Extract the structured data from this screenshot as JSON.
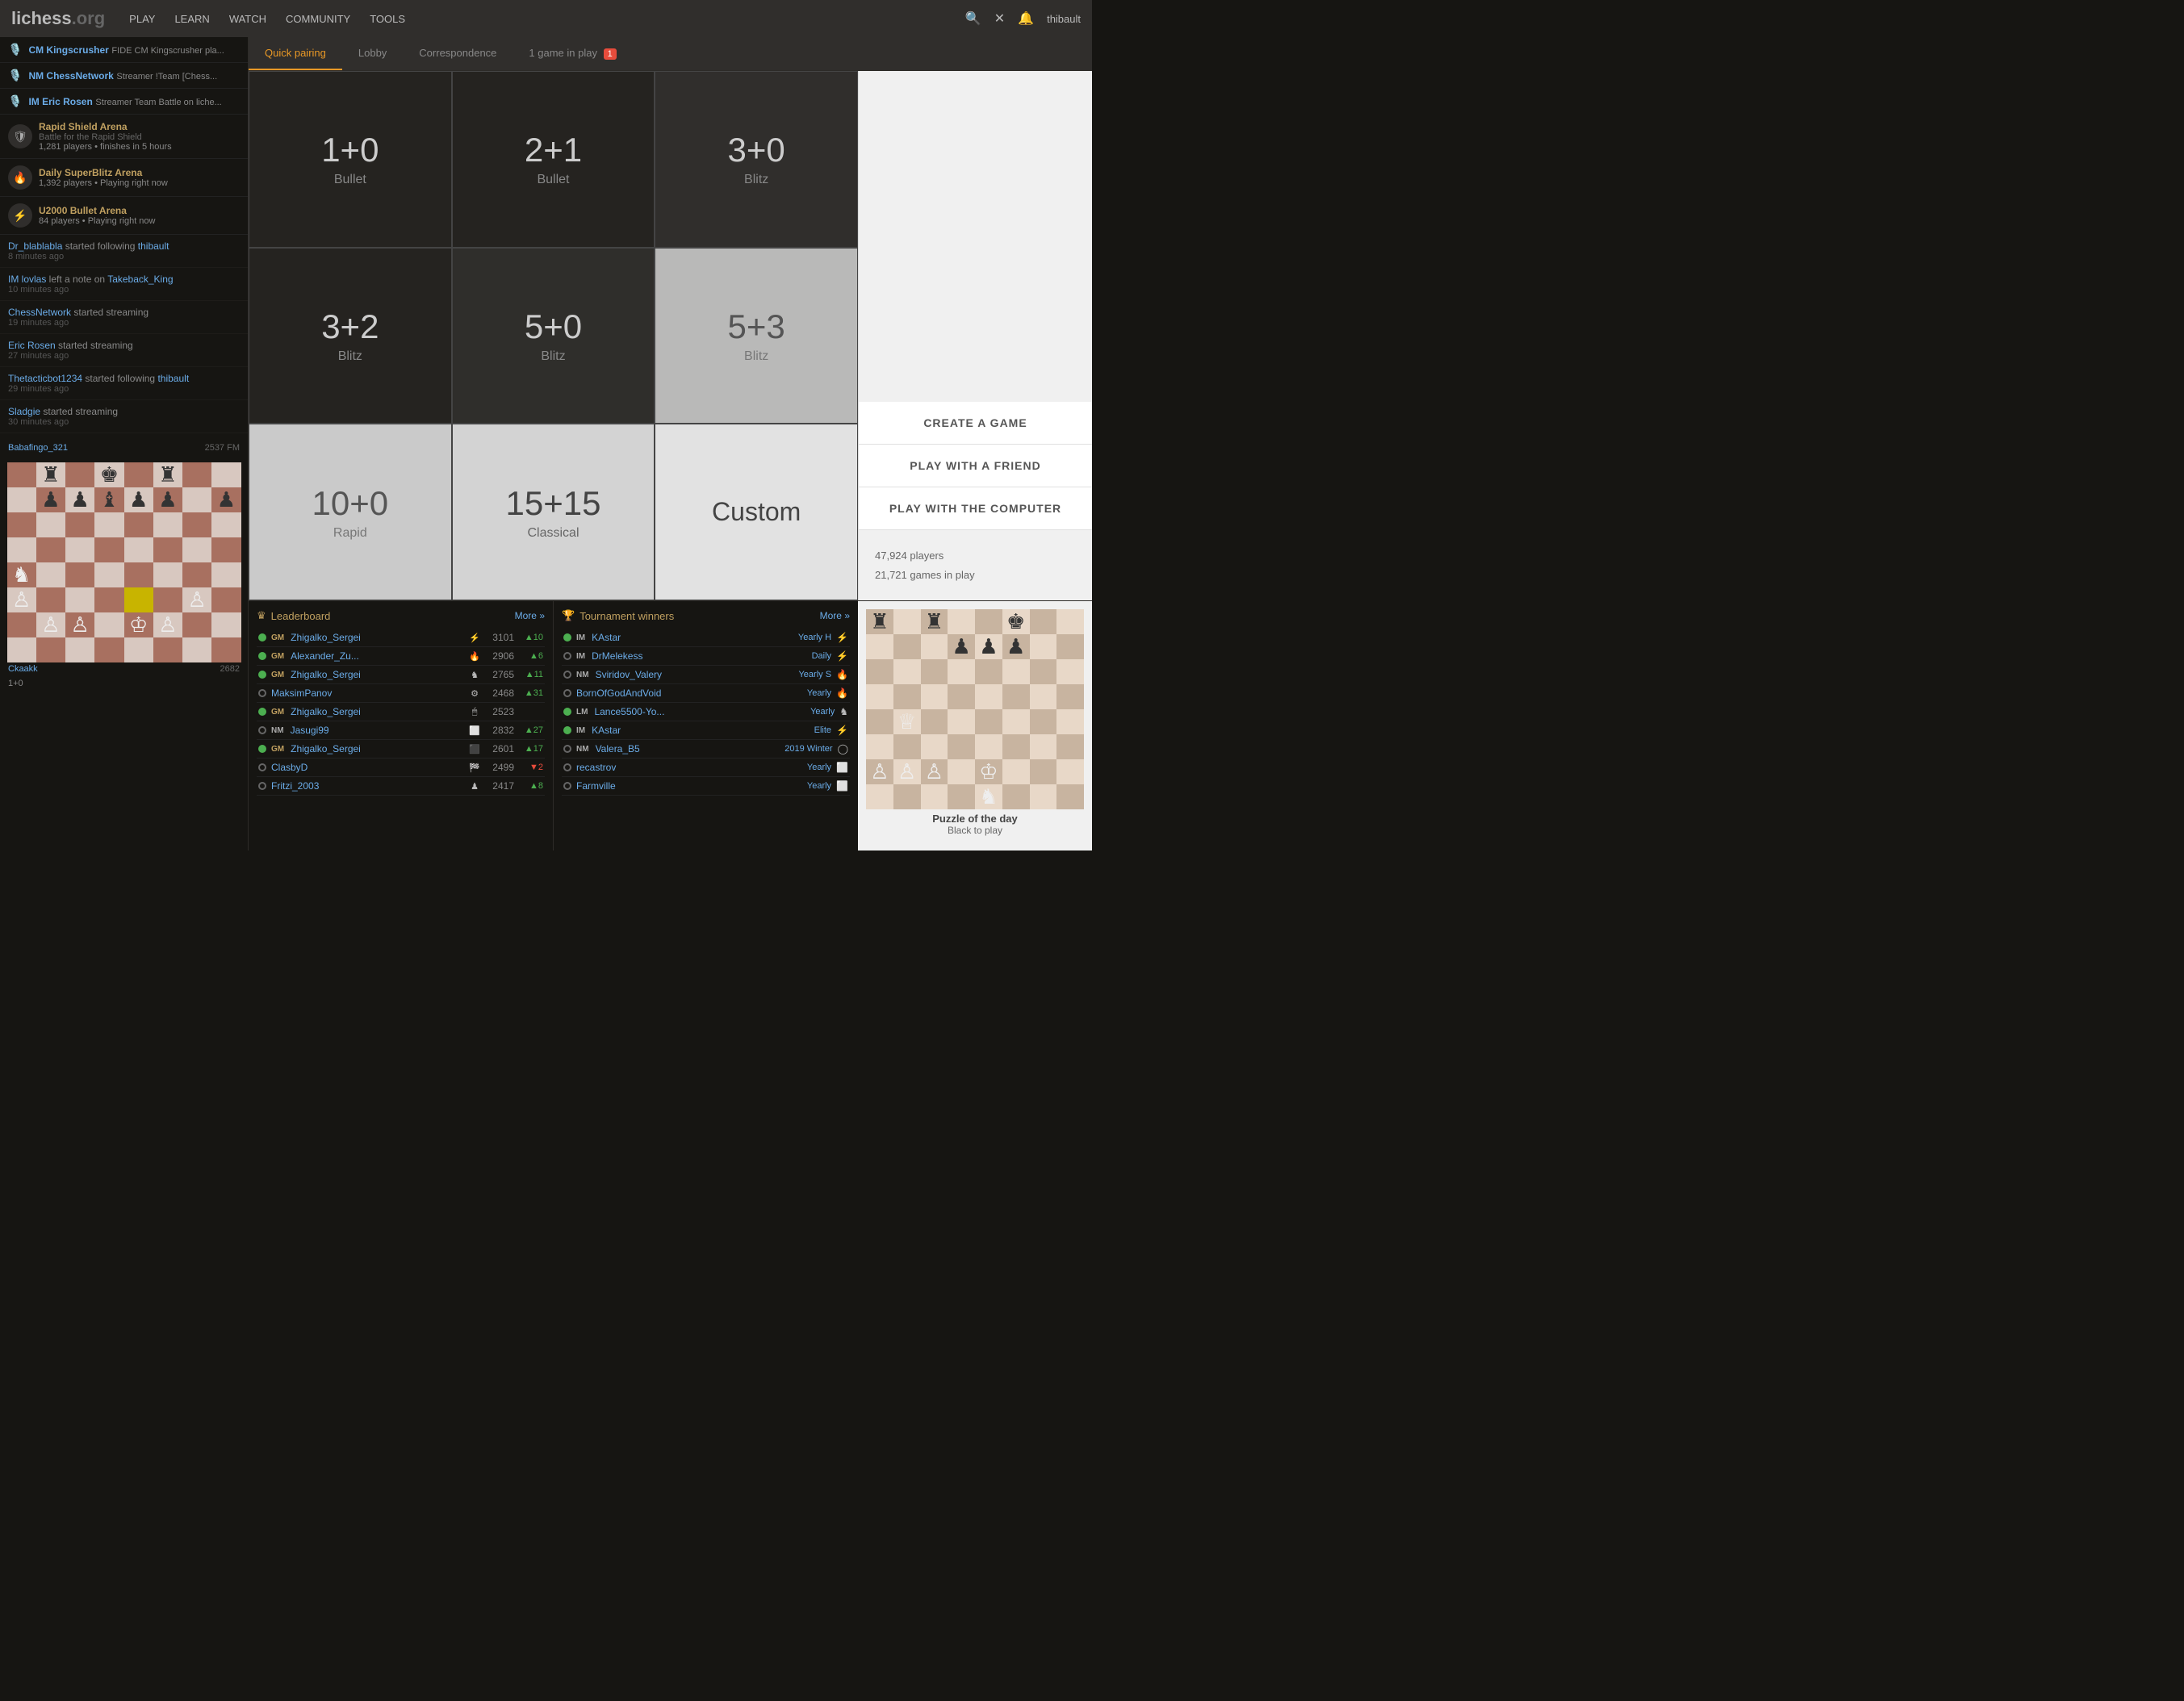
{
  "header": {
    "logo": "lichess",
    "logo_suffix": ".org",
    "nav": [
      "PLAY",
      "LEARN",
      "WATCH",
      "COMMUNITY",
      "TOOLS"
    ],
    "username": "thibault",
    "search_icon": "🔍",
    "close_icon": "✕",
    "bell_icon": "🔔"
  },
  "tabs": [
    {
      "label": "Quick pairing",
      "active": true
    },
    {
      "label": "Lobby"
    },
    {
      "label": "Correspondence"
    },
    {
      "label": "1 game in play",
      "badge": "1"
    }
  ],
  "streamers": [
    {
      "icon": "🎙️",
      "name": "CM Kingscrusher",
      "text": "FIDE CM Kingscrusher pla..."
    },
    {
      "icon": "🎙️",
      "name": "NM ChessNetwork",
      "text": "Streamer !Team [Chess..."
    },
    {
      "icon": "🎙️",
      "name": "IM Eric Rosen",
      "text": "Streamer Team Battle on liche..."
    }
  ],
  "tournaments": [
    {
      "icon": "shield",
      "name": "Rapid Shield Arena",
      "sub": "Battle for the Rapid Shield",
      "players": "1,281 players",
      "time": "finishes in 5 hours"
    },
    {
      "icon": "fire",
      "name": "Daily SuperBlitz Arena",
      "sub": "1,392 players",
      "time": "Playing right now"
    },
    {
      "icon": "bolt",
      "name": "U2000 Bullet Arena",
      "sub": "84 players",
      "time": "Playing right now"
    }
  ],
  "activity": [
    {
      "text": "Dr_blablabla started following thibault",
      "time": "8 minutes ago"
    },
    {
      "text": "IM lovlas left a note on Takeback_King",
      "time": "10 minutes ago"
    },
    {
      "text": "ChessNetwork started streaming",
      "time": "19 minutes ago"
    },
    {
      "text": "Eric Rosen started streaming",
      "time": "27 minutes ago"
    },
    {
      "text": "Thetacticbot1234 started following thibault",
      "time": "29 minutes ago"
    },
    {
      "text": "Sladgie started streaming",
      "time": "30 minutes ago"
    }
  ],
  "game_modes": [
    {
      "time": "1+0",
      "type": "Bullet",
      "theme": "dark"
    },
    {
      "time": "2+1",
      "type": "Bullet",
      "theme": "dark"
    },
    {
      "time": "3+0",
      "type": "Blitz",
      "theme": "dark"
    },
    {
      "time": "3+2",
      "type": "Blitz",
      "theme": "dark"
    },
    {
      "time": "5+0",
      "type": "Blitz",
      "theme": "dark"
    },
    {
      "time": "5+3",
      "type": "Blitz",
      "theme": "dark"
    },
    {
      "time": "10+0",
      "type": "Rapid",
      "theme": "dark"
    },
    {
      "time": "15+15",
      "type": "Classical",
      "theme": "dark"
    },
    {
      "time": "Custom",
      "type": "",
      "theme": "light"
    }
  ],
  "actions": [
    {
      "label": "CREATE A GAME"
    },
    {
      "label": "PLAY WITH A FRIEND"
    },
    {
      "label": "PLAY WITH THE COMPUTER"
    }
  ],
  "stats": {
    "players": "47,924 players",
    "games": "21,721 games in play"
  },
  "leaderboard": {
    "title": "Leaderboard",
    "more": "More »",
    "rows": [
      {
        "circle": "green",
        "title": "GM",
        "name": "Zhigalko_Sergei",
        "icon": "⚡",
        "rating": "3101",
        "gain": "▲10",
        "positive": true
      },
      {
        "circle": "green",
        "title": "GM",
        "name": "Alexander_Zu...",
        "icon": "🔥",
        "rating": "2906",
        "gain": "▲6",
        "positive": true
      },
      {
        "circle": "green",
        "title": "GM",
        "name": "Zhigalko_Sergei",
        "icon": "♞",
        "rating": "2765",
        "gain": "▲11",
        "positive": true
      },
      {
        "circle": "",
        "title": "",
        "name": "MaksimPanov",
        "icon": "⚙",
        "rating": "2468",
        "gain": "▲31",
        "positive": true
      },
      {
        "circle": "green",
        "title": "GM",
        "name": "Zhigalko_Sergei",
        "icon": "🖱",
        "rating": "2523",
        "gain": "",
        "positive": true
      },
      {
        "circle": "",
        "title": "NM",
        "name": "Jasugi99",
        "icon": "🔲",
        "rating": "2832",
        "gain": "▲27",
        "positive": true
      },
      {
        "circle": "green",
        "title": "GM",
        "name": "Zhigalko_Sergei",
        "icon": "🔳",
        "rating": "2601",
        "gain": "▲17",
        "positive": true
      },
      {
        "circle": "",
        "title": "",
        "name": "ClasbyD",
        "icon": "🏁",
        "rating": "2499",
        "gain": "▼2",
        "positive": false
      },
      {
        "circle": "",
        "title": "",
        "name": "Fritzi_2003",
        "icon": "♟",
        "rating": "2417",
        "gain": "▲8",
        "positive": true
      }
    ]
  },
  "tournament_winners": {
    "title": "Tournament winners",
    "more": "More »",
    "rows": [
      {
        "circle": "green",
        "title": "IM",
        "name": "KAstar",
        "type": "Yearly H",
        "icon": "⚡"
      },
      {
        "circle": "",
        "title": "IM",
        "name": "DrMelekess",
        "type": "Daily",
        "icon": "⚡"
      },
      {
        "circle": "",
        "title": "NM",
        "name": "Sviridov_Valery",
        "type": "Yearly S",
        "icon": "🔥"
      },
      {
        "circle": "",
        "title": "",
        "name": "BornOfGodAndVoid",
        "type": "Yearly",
        "icon": "🔥"
      },
      {
        "circle": "green",
        "title": "LM",
        "name": "Lance5500-Yo...",
        "type": "Yearly",
        "icon": "♞"
      },
      {
        "circle": "green",
        "title": "IM",
        "name": "KAstar",
        "type": "Elite",
        "icon": "⚡"
      },
      {
        "circle": "",
        "title": "NM",
        "name": "Valera_B5",
        "type": "2019 Winter",
        "icon": "◯"
      },
      {
        "circle": "",
        "title": "",
        "name": "recastrov",
        "type": "Yearly",
        "icon": "🔲"
      },
      {
        "circle": "",
        "title": "",
        "name": "Farmville",
        "type": "Yearly",
        "icon": "🔲"
      }
    ]
  },
  "board_game": {
    "player1": "Ckaakk",
    "rating1": "2682",
    "player2": "Babafingo_321",
    "rating2": "2537",
    "suffix2": "FM",
    "time": "1+0"
  },
  "puzzle": {
    "title": "Puzzle of the day",
    "subtitle": "Black to play"
  }
}
